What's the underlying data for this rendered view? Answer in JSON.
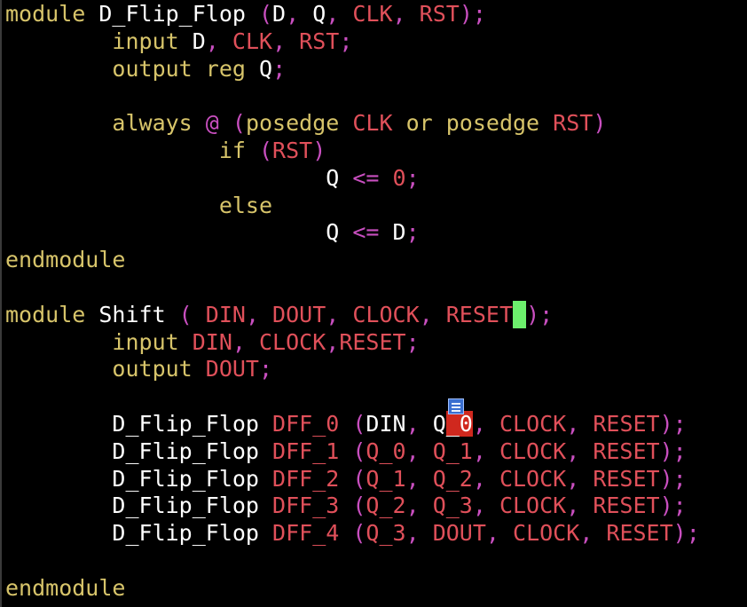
{
  "editor": {
    "cursor_char": " ",
    "lines": [
      {
        "tokens": [
          [
            "module ",
            "kw"
          ],
          [
            "D_Flip_Flop ",
            "id"
          ],
          [
            "(",
            "pn"
          ],
          [
            "D",
            "id"
          ],
          [
            ", ",
            "pn"
          ],
          [
            "Q",
            "id"
          ],
          [
            ", ",
            "pn"
          ],
          [
            "CLK",
            "sig"
          ],
          [
            ", ",
            "pn"
          ],
          [
            "RST",
            "sig"
          ],
          [
            ");",
            "pn"
          ]
        ]
      },
      {
        "tokens": [
          [
            "        ",
            "id"
          ],
          [
            "input ",
            "typ"
          ],
          [
            "D",
            "id"
          ],
          [
            ", ",
            "pn"
          ],
          [
            "CLK",
            "sig"
          ],
          [
            ", ",
            "pn"
          ],
          [
            "RST",
            "sig"
          ],
          [
            ";",
            "pn"
          ]
        ]
      },
      {
        "tokens": [
          [
            "        ",
            "id"
          ],
          [
            "output ",
            "typ"
          ],
          [
            "reg ",
            "typ"
          ],
          [
            "Q",
            "id"
          ],
          [
            ";",
            "pn"
          ]
        ]
      },
      {
        "tokens": []
      },
      {
        "tokens": [
          [
            "        ",
            "id"
          ],
          [
            "always ",
            "kw"
          ],
          [
            "@ ",
            "pn"
          ],
          [
            "(",
            "pn"
          ],
          [
            "posedge ",
            "kw"
          ],
          [
            "CLK ",
            "sig"
          ],
          [
            "or ",
            "kw"
          ],
          [
            "posedge ",
            "kw"
          ],
          [
            "RST",
            "sig"
          ],
          [
            ")",
            "pn"
          ]
        ]
      },
      {
        "tokens": [
          [
            "                ",
            "id"
          ],
          [
            "if ",
            "kw"
          ],
          [
            "(",
            "pn"
          ],
          [
            "RST",
            "sig"
          ],
          [
            ")",
            "pn"
          ]
        ]
      },
      {
        "tokens": [
          [
            "                        ",
            "id"
          ],
          [
            "Q ",
            "id"
          ],
          [
            "<= ",
            "pn"
          ],
          [
            "0",
            "num"
          ],
          [
            ";",
            "pn"
          ]
        ]
      },
      {
        "tokens": [
          [
            "                ",
            "id"
          ],
          [
            "else",
            "kw"
          ]
        ]
      },
      {
        "tokens": [
          [
            "                        ",
            "id"
          ],
          [
            "Q ",
            "id"
          ],
          [
            "<= ",
            "pn"
          ],
          [
            "D",
            "id"
          ],
          [
            ";",
            "pn"
          ]
        ]
      },
      {
        "tokens": [
          [
            "endmodule",
            "kw"
          ]
        ]
      },
      {
        "tokens": []
      },
      {
        "tokens": [
          [
            "module ",
            "kw"
          ],
          [
            "Shift ",
            "id"
          ],
          [
            "( ",
            "pn"
          ],
          [
            "DIN",
            "sig"
          ],
          [
            ", ",
            "pn"
          ],
          [
            "DOUT",
            "sig"
          ],
          [
            ", ",
            "pn"
          ],
          [
            "CLOCK",
            "sig"
          ],
          [
            ", ",
            "pn"
          ],
          [
            "RESET",
            "sig"
          ],
          [
            "CURSOR",
            "cursor"
          ],
          [
            ");",
            "pn"
          ]
        ]
      },
      {
        "tokens": [
          [
            "        ",
            "id"
          ],
          [
            "input ",
            "typ"
          ],
          [
            "DIN",
            "sig"
          ],
          [
            ", ",
            "pn"
          ],
          [
            "CLOCK",
            "sig"
          ],
          [
            ",",
            "pn"
          ],
          [
            "RESET",
            "sig"
          ],
          [
            ";",
            "pn"
          ]
        ]
      },
      {
        "tokens": [
          [
            "        ",
            "id"
          ],
          [
            "output ",
            "typ"
          ],
          [
            "DOUT",
            "sig"
          ],
          [
            ";",
            "pn"
          ]
        ]
      },
      {
        "tokens": []
      },
      {
        "tokens": [
          [
            "        ",
            "id"
          ],
          [
            "D_Flip_Flop ",
            "id"
          ],
          [
            "DFF_0 ",
            "sig"
          ],
          [
            "(",
            "pn"
          ],
          [
            "DIN",
            "id"
          ],
          [
            ", ",
            "pn"
          ],
          [
            "Q",
            "id"
          ],
          [
            "_0",
            "errhl"
          ],
          [
            ", ",
            "pn"
          ],
          [
            "CLOCK",
            "sig"
          ],
          [
            ", ",
            "pn"
          ],
          [
            "RESET",
            "sig"
          ],
          [
            ");",
            "pn"
          ]
        ]
      },
      {
        "tokens": [
          [
            "        ",
            "id"
          ],
          [
            "D_Flip_Flop ",
            "id"
          ],
          [
            "DFF_1 ",
            "sig"
          ],
          [
            "(",
            "pn"
          ],
          [
            "Q_0",
            "sig"
          ],
          [
            ", ",
            "pn"
          ],
          [
            "Q_1",
            "sig"
          ],
          [
            ", ",
            "pn"
          ],
          [
            "CLOCK",
            "sig"
          ],
          [
            ", ",
            "pn"
          ],
          [
            "RESET",
            "sig"
          ],
          [
            ");",
            "pn"
          ]
        ]
      },
      {
        "tokens": [
          [
            "        ",
            "id"
          ],
          [
            "D_Flip_Flop ",
            "id"
          ],
          [
            "DFF_2 ",
            "sig"
          ],
          [
            "(",
            "pn"
          ],
          [
            "Q_1",
            "sig"
          ],
          [
            ", ",
            "pn"
          ],
          [
            "Q_2",
            "sig"
          ],
          [
            ", ",
            "pn"
          ],
          [
            "CLOCK",
            "sig"
          ],
          [
            ", ",
            "pn"
          ],
          [
            "RESET",
            "sig"
          ],
          [
            ");",
            "pn"
          ]
        ]
      },
      {
        "tokens": [
          [
            "        ",
            "id"
          ],
          [
            "D_Flip_Flop ",
            "id"
          ],
          [
            "DFF_3 ",
            "sig"
          ],
          [
            "(",
            "pn"
          ],
          [
            "Q_2",
            "sig"
          ],
          [
            ", ",
            "pn"
          ],
          [
            "Q_3",
            "sig"
          ],
          [
            ", ",
            "pn"
          ],
          [
            "CLOCK",
            "sig"
          ],
          [
            ", ",
            "pn"
          ],
          [
            "RESET",
            "sig"
          ],
          [
            ");",
            "pn"
          ]
        ]
      },
      {
        "tokens": [
          [
            "        ",
            "id"
          ],
          [
            "D_Flip_Flop ",
            "id"
          ],
          [
            "DFF_4 ",
            "sig"
          ],
          [
            "(",
            "pn"
          ],
          [
            "Q_3",
            "sig"
          ],
          [
            ", ",
            "pn"
          ],
          [
            "DOUT",
            "sig"
          ],
          [
            ", ",
            "pn"
          ],
          [
            "CLOCK",
            "sig"
          ],
          [
            ", ",
            "pn"
          ],
          [
            "RESET",
            "sig"
          ],
          [
            ");",
            "pn"
          ]
        ]
      },
      {
        "tokens": []
      },
      {
        "tokens": [
          [
            "endmodule",
            "kw"
          ]
        ]
      }
    ]
  },
  "colors": {
    "background": "#000000",
    "keyword": "#d7c46a",
    "signal": "#e0505a",
    "punctuation": "#c94fc0",
    "cursor": "#6cf06c",
    "error_highlight": "#d0281e"
  },
  "icons": {
    "sign": "note-sign-icon"
  }
}
